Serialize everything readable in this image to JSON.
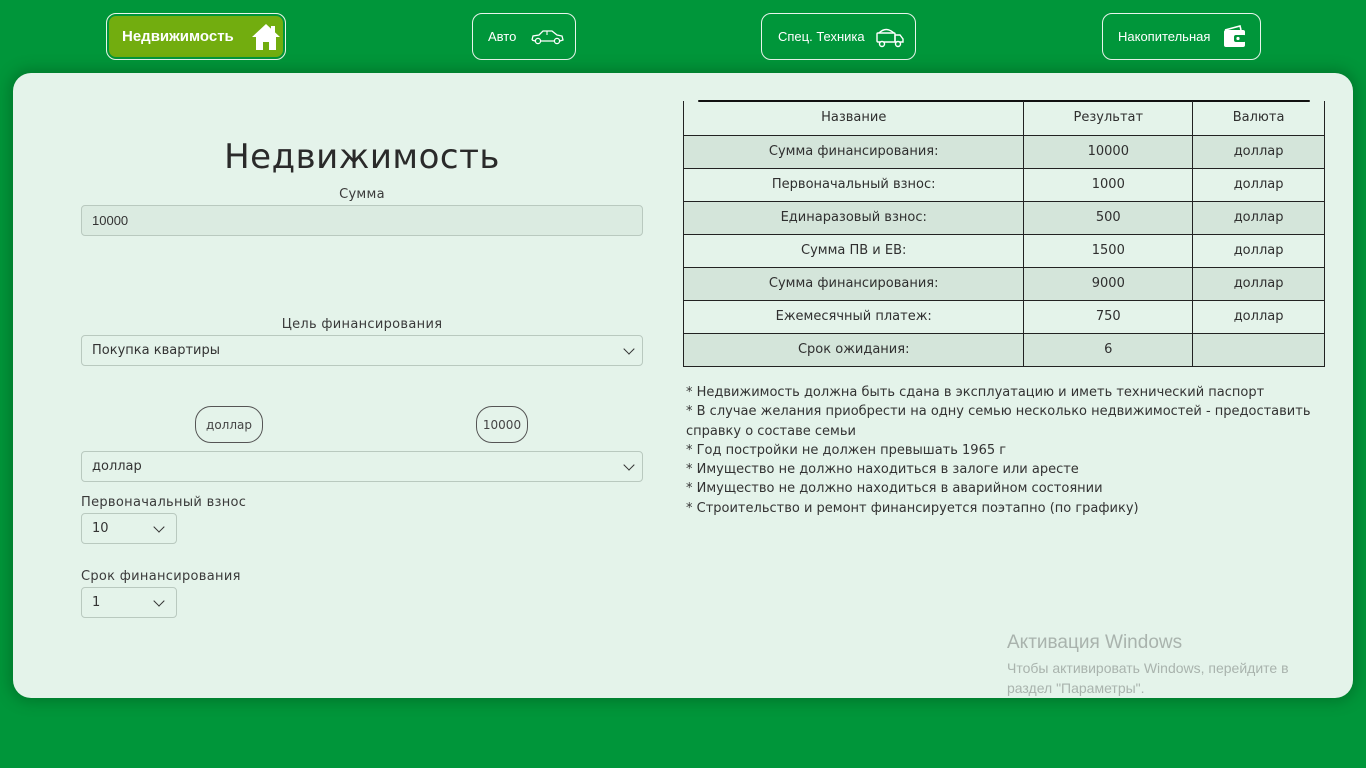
{
  "nav": [
    {
      "label": "Недвижимость",
      "icon": "house-icon",
      "active": true
    },
    {
      "label": "Авто",
      "icon": "car-icon",
      "active": false
    },
    {
      "label": "Спец. Техника",
      "icon": "truck-icon",
      "active": false
    },
    {
      "label": "Накопительная",
      "icon": "wallet-icon",
      "active": false
    }
  ],
  "colors": {
    "background": "#00963a",
    "card": "#e4f3ea",
    "active_nav": "#72ad0f"
  },
  "form": {
    "title": "Недвижимость",
    "sum_label": "Сумма",
    "sum_value": "10000",
    "purpose_label": "Цель финансирования",
    "purpose_value": "Покупка квартиры",
    "currency_pill": "доллар",
    "amount_pill": "10000",
    "currency_value": "доллар",
    "down_payment_label": "Первоначальный взнос",
    "down_payment_value": "10",
    "term_label": "Срок финансирования",
    "term_value": "1"
  },
  "table": {
    "headers": [
      "Название",
      "Результат",
      "Валюта"
    ],
    "rows": [
      [
        "Сумма финансирования:",
        "10000",
        "доллар"
      ],
      [
        "Первоначальный взнос:",
        "1000",
        "доллар"
      ],
      [
        "Единаразовый взнос:",
        "500",
        "доллар"
      ],
      [
        "Сумма ПВ и ЕВ:",
        "1500",
        "доллар"
      ],
      [
        "Сумма финансирования:",
        "9000",
        "доллар"
      ],
      [
        "Ежемесячный платеж:",
        "750",
        "доллар"
      ],
      [
        "Срок ожидания:",
        "6",
        ""
      ]
    ]
  },
  "notes": [
    "* Недвижимость должна быть сдана в эксплуатацию и иметь технический паспорт",
    "* В случае желания приобрести на одну семью несколько недвижимостей - предоставить справку о составе семьи",
    "* Год постройки не должен превышать 1965 г",
    "* Имущество не должно находиться в залоге или аресте",
    "* Имущество не должно находиться в аварийном состоянии",
    "* Строительство и ремонт финансируется поэтапно (по графику)"
  ],
  "watermark": {
    "title": "Активация Windows",
    "text": "Чтобы активировать Windows, перейдите в раздел \"Параметры\"."
  }
}
